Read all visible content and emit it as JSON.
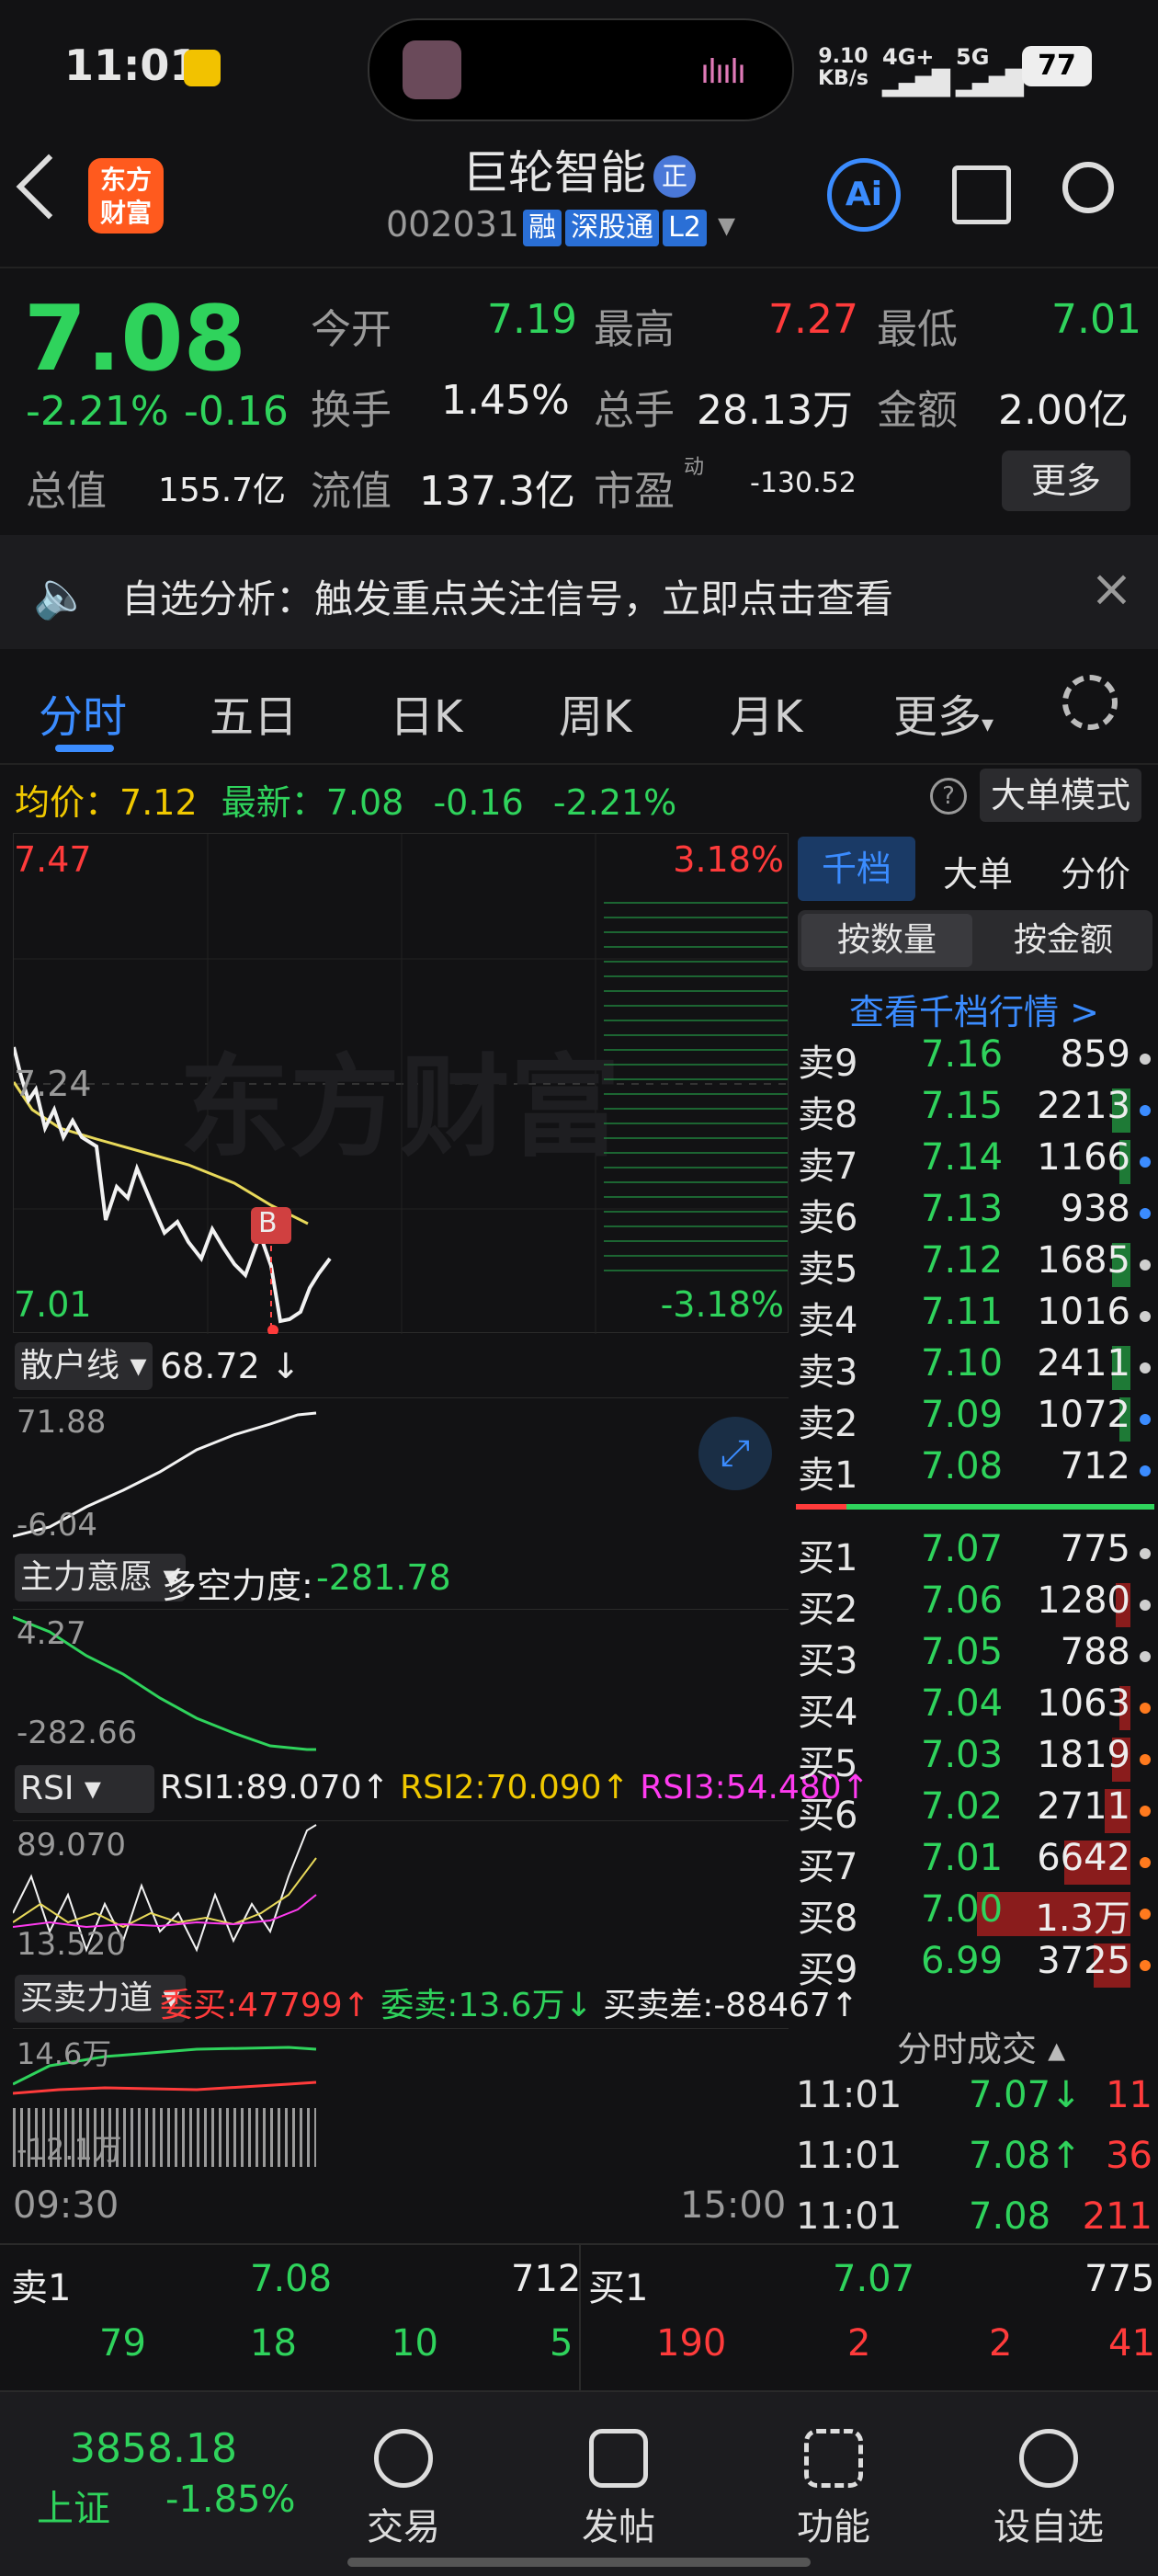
{
  "status_bar": {
    "time": "11:01",
    "net_speed": "9.10",
    "net_unit": "KB/s",
    "net1": "4G+",
    "net2": "5G",
    "battery": "77"
  },
  "header": {
    "title": "巨轮智能",
    "title_badge": "正",
    "code": "002031",
    "tags": [
      "融",
      "深股通",
      "L2"
    ],
    "logo_line1": "东方",
    "logo_line2": "财富",
    "ai_label": "Ai"
  },
  "quote": {
    "price": "7.08",
    "change_pct": "-2.21%",
    "change": "-0.16",
    "open_label": "今开",
    "open": "7.19",
    "high_label": "最高",
    "high": "7.27",
    "low_label": "最低",
    "low": "7.01",
    "turnover_label": "换手",
    "turnover": "1.45%",
    "volume_label": "总手",
    "volume": "28.13万",
    "amount_label": "金额",
    "amount": "2.00亿",
    "mktcap_label": "总值",
    "mktcap": "155.7亿",
    "float_label": "流值",
    "float": "137.3亿",
    "pe_label": "市盈",
    "pe_sup": "动",
    "pe": "-130.52",
    "more": "更多"
  },
  "notice": {
    "text": "自选分析：触发重点关注信号，立即点击查看"
  },
  "tabs": [
    "分时",
    "五日",
    "日K",
    "周K",
    "月K",
    "更多"
  ],
  "chart_info": {
    "avg_label": "均价：",
    "avg": "7.12",
    "latest_label": "最新：",
    "latest": "7.08",
    "chg": "-0.16",
    "pct": "-2.21%",
    "big_order_mode": "大单模式"
  },
  "intraday": {
    "y_high": "7.47",
    "y_mid": "7.24",
    "y_low": "7.01",
    "pct_high": "3.18%",
    "pct_low": "-3.18%",
    "time_start": "09:30",
    "time_end": "15:00",
    "watermark": "东方财富",
    "marker": "B"
  },
  "indicators": {
    "retail": {
      "name": "散户线",
      "value": "68.72 ↓",
      "max": "71.88",
      "min": "-6.04"
    },
    "main": {
      "name": "主力意愿",
      "label": "多空力度:",
      "value": "-281.78",
      "max": "4.27",
      "min": "-282.66"
    },
    "rsi": {
      "name": "RSI",
      "rsi1": "RSI1:89.070↑",
      "rsi2": "RSI2:70.090↑",
      "rsi3": "RSI3:54.480↑",
      "max": "89.070",
      "min": "13.520"
    },
    "bs": {
      "name": "买卖力道",
      "buy": "委买:47799↑",
      "sell": "委卖:13.6万↓",
      "diff": "买卖差:-88467↑",
      "max": "14.6万",
      "min": "-12.1万"
    }
  },
  "book_tabs": {
    "t1": "千档",
    "t2": "大单",
    "t3": "分价",
    "s1": "按数量",
    "s2": "按金额",
    "link": "查看千档行情 >"
  },
  "asks": [
    {
      "label": "卖9",
      "price": "7.16",
      "vol": "859",
      "level": 0.0,
      "dot": "#cfcfcf"
    },
    {
      "label": "卖8",
      "price": "7.15",
      "vol": "2213",
      "level": 0.05,
      "dot": "#3b8cff"
    },
    {
      "label": "卖7",
      "price": "7.14",
      "vol": "1166",
      "level": 0.03,
      "dot": "#3b8cff"
    },
    {
      "label": "卖6",
      "price": "7.13",
      "vol": "938",
      "level": 0.0,
      "dot": "#3b8cff"
    },
    {
      "label": "卖5",
      "price": "7.12",
      "vol": "1685",
      "level": 0.05,
      "dot": "#cfcfcf"
    },
    {
      "label": "卖4",
      "price": "7.11",
      "vol": "1016",
      "level": 0.0,
      "dot": "#cfcfcf"
    },
    {
      "label": "卖3",
      "price": "7.10",
      "vol": "2411",
      "level": 0.05,
      "dot": "#cfcfcf"
    },
    {
      "label": "卖2",
      "price": "7.09",
      "vol": "1072",
      "level": 0.03,
      "dot": "#3b8cff"
    },
    {
      "label": "卖1",
      "price": "7.08",
      "vol": "712",
      "level": 0.0,
      "dot": "#3b8cff"
    }
  ],
  "bids": [
    {
      "label": "买1",
      "price": "7.07",
      "vol": "775",
      "level": 0.0,
      "dot": "#cfcfcf"
    },
    {
      "label": "买2",
      "price": "7.06",
      "vol": "1280",
      "level": 0.04,
      "dot": "#cfcfcf"
    },
    {
      "label": "买3",
      "price": "7.05",
      "vol": "788",
      "level": 0.0,
      "dot": "#cfcfcf"
    },
    {
      "label": "买4",
      "price": "7.04",
      "vol": "1063",
      "level": 0.03,
      "dot": "#ff7a1e"
    },
    {
      "label": "买5",
      "price": "7.03",
      "vol": "1819",
      "level": 0.05,
      "dot": "#ff7a1e"
    },
    {
      "label": "买6",
      "price": "7.02",
      "vol": "2711",
      "level": 0.07,
      "dot": "#ff7a1e"
    },
    {
      "label": "买7",
      "price": "7.01",
      "vol": "6642",
      "level": 0.18,
      "dot": "#ff7a1e"
    },
    {
      "label": "买8",
      "price": "7.00",
      "vol": "1.3万",
      "level": 0.42,
      "dot": "#ff7a1e"
    },
    {
      "label": "买9",
      "price": "6.99",
      "vol": "3725",
      "level": 0.1,
      "dot": "#ff7a1e"
    }
  ],
  "ticks": {
    "title": "分时成交",
    "rows": [
      {
        "time": "11:01",
        "price": "7.07↓",
        "vol": "11"
      },
      {
        "time": "11:01",
        "price": "7.08↑",
        "vol": "36"
      },
      {
        "time": "11:01",
        "price": "7.08",
        "vol": "211"
      }
    ]
  },
  "bottom_quote": {
    "ask_label": "卖1",
    "ask_price": "7.08",
    "ask_vol": "712",
    "bid_label": "买1",
    "bid_price": "7.07",
    "bid_vol": "775",
    "ask_detail": [
      "79",
      "18",
      "10",
      "5"
    ],
    "bid_detail": [
      "190",
      "2",
      "2",
      "41"
    ]
  },
  "bottom_nav": {
    "index_value": "3858.18",
    "index_name": "上证",
    "index_change": "-1.85%",
    "items": [
      "交易",
      "发帖",
      "功能",
      "设自选"
    ]
  }
}
